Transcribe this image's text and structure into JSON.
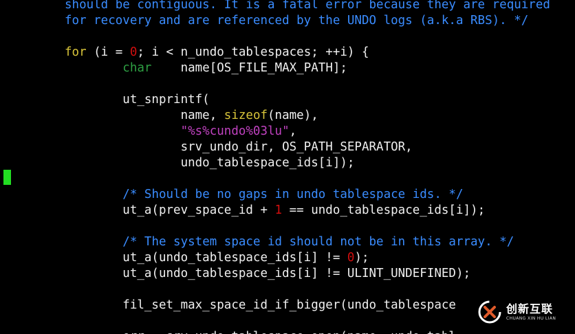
{
  "editor": {
    "lines": [
      [
        {
          "t": "should be contiguous. It is a fatal error because they are required",
          "c": "comment"
        }
      ],
      [
        {
          "t": "for recovery and are referenced by the UNDO logs (a.k.a RBS). */",
          "c": "comment"
        }
      ],
      [],
      [
        {
          "t": "for",
          "c": "keyword"
        },
        {
          "t": " (i = ",
          "c": "plain"
        },
        {
          "t": "0",
          "c": "number"
        },
        {
          "t": "; i < n_undo_tablespaces; ++i) {",
          "c": "plain"
        }
      ],
      [
        {
          "t": "        ",
          "c": "plain"
        },
        {
          "t": "char",
          "c": "type"
        },
        {
          "t": "    name[OS_FILE_MAX_PATH];",
          "c": "plain"
        }
      ],
      [],
      [
        {
          "t": "        ut_snprintf(",
          "c": "plain"
        }
      ],
      [
        {
          "t": "                name, ",
          "c": "plain"
        },
        {
          "t": "sizeof",
          "c": "keyword"
        },
        {
          "t": "(name),",
          "c": "plain"
        }
      ],
      [
        {
          "t": "                ",
          "c": "plain"
        },
        {
          "t": "\"%s%cundo%03lu\"",
          "c": "string"
        },
        {
          "t": ",",
          "c": "plain"
        }
      ],
      [
        {
          "t": "                srv_undo_dir, OS_PATH_SEPARATOR,",
          "c": "plain"
        }
      ],
      [
        {
          "t": "                undo_tablespace_ids[i]);",
          "c": "plain"
        }
      ],
      [],
      [
        {
          "t": "        ",
          "c": "plain"
        },
        {
          "t": "/* Should be no gaps in undo tablespace ids. */",
          "c": "comment"
        }
      ],
      [
        {
          "t": "        ut_a(prev_space_id + ",
          "c": "plain"
        },
        {
          "t": "1",
          "c": "number"
        },
        {
          "t": " == undo_tablespace_ids[i]);",
          "c": "plain"
        }
      ],
      [],
      [
        {
          "t": "        ",
          "c": "plain"
        },
        {
          "t": "/* The system space id should not be in this array. */",
          "c": "comment"
        }
      ],
      [
        {
          "t": "        ut_a(undo_tablespace_ids[i] != ",
          "c": "plain"
        },
        {
          "t": "0",
          "c": "number"
        },
        {
          "t": ");",
          "c": "plain"
        }
      ],
      [
        {
          "t": "        ut_a(undo_tablespace_ids[i] != ULINT_UNDEFINED);",
          "c": "plain"
        }
      ],
      [],
      [
        {
          "t": "        fil_set_max_space_id_if_bigger(undo_tablespace",
          "c": "plain"
        }
      ],
      [],
      [
        {
          "t": "        err = srv_undo_tablespace_open(name, undo_tabl",
          "c": "plain"
        }
      ]
    ]
  },
  "colors": {
    "background": "#000000",
    "comment": "#3a8cff",
    "keyword": "#d8c43a",
    "type": "#2ea043",
    "number": "#d10e0e",
    "string": "#c042c0",
    "plain": "#f0f0f0",
    "cursor": "#22dd22"
  },
  "watermark": {
    "logo_icon": "chuangxin-logo-icon",
    "name_cn": "创新互联",
    "name_en": "CHUANG XIN HU LIAN"
  }
}
